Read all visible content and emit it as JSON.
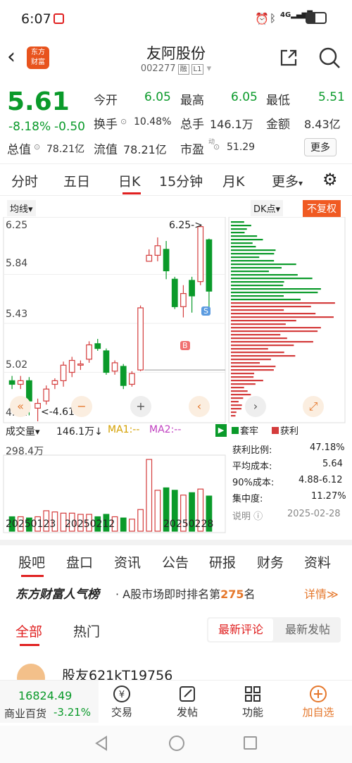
{
  "status": {
    "time": "6:07",
    "icons": [
      "notification-icon",
      "alarm-icon",
      "bluetooth-icon",
      "signal-icon",
      "battery-icon"
    ]
  },
  "header": {
    "title": "友阿股份",
    "code": "002277",
    "tag1": "融",
    "tag2": "L1",
    "logo": "东方\n财富"
  },
  "quote": {
    "price": "5.61",
    "change_pct": "-8.18%",
    "change": "-0.50",
    "open_label": "今开",
    "open": "6.05",
    "high_label": "最高",
    "high": "6.05",
    "low_label": "最低",
    "low": "5.51",
    "turnover_label": "换手",
    "turnover": "10.48%",
    "volume_label": "总手",
    "volume": "146.1万",
    "amount_label": "金额",
    "amount": "8.43亿",
    "mktcap_label": "总值",
    "mktcap": "78.21亿",
    "float_label": "流值",
    "float": "78.21亿",
    "pe_label": "市盈",
    "pe_sup": "动",
    "pe": "51.29",
    "more": "更多"
  },
  "tabs": [
    "分时",
    "五日",
    "日K",
    "15分钟",
    "月K",
    "更多"
  ],
  "chart": {
    "ma_label": "均线",
    "dk_label": "DK点",
    "fq_label": "不复权",
    "y_ticks": [
      "6.25",
      "5.84",
      "5.43",
      "5.02",
      "4.61"
    ],
    "high_annot": "6.25->",
    "low_annot": "<-4.61",
    "marker_b": "B",
    "marker_s": "S",
    "vol_label": "成交量",
    "vol_value": "146.1万↓",
    "ma1": "MA1:--",
    "ma2": "MA2:--",
    "vol_max": "298.4万",
    "dates": [
      "20250123",
      "20250212",
      "20250228"
    ]
  },
  "chip": {
    "legend_lock": "套牢",
    "legend_profit": "获利",
    "rows": [
      {
        "label": "获利比例:",
        "value": "47.18%"
      },
      {
        "label": "平均成本:",
        "value": "5.64"
      },
      {
        "label": "90%成本:",
        "value": "4.88-6.12"
      },
      {
        "label": "集中度:",
        "value": "11.27%"
      }
    ],
    "note": "说明",
    "date": "2025-02-28"
  },
  "news_tabs": [
    "股吧",
    "盘口",
    "资讯",
    "公告",
    "研报",
    "财务",
    "资料"
  ],
  "rank": {
    "brand": "东方财富人气榜",
    "text": "· A股市场即时排名第",
    "num": "275",
    "suffix": "名",
    "detail": "详情"
  },
  "comment_tabs": {
    "all": "全部",
    "hot": "热门",
    "latest_comment": "最新评论",
    "latest_post": "最新发帖"
  },
  "post": {
    "user": "股友621kT19756"
  },
  "bottom": {
    "index_value": "16824.49",
    "index_name": "商业百货",
    "index_change": "-3.21%",
    "trade": "交易",
    "post": "发帖",
    "func": "功能",
    "add": "加自选"
  },
  "chart_data": {
    "type": "candlestick",
    "y_range": [
      4.61,
      6.25
    ],
    "candles": [
      [
        4.95,
        4.92,
        4.99,
        4.88
      ],
      [
        4.92,
        4.95,
        4.99,
        4.88
      ],
      [
        4.95,
        4.78,
        4.98,
        4.66
      ],
      [
        4.72,
        4.76,
        4.8,
        4.61
      ],
      [
        4.78,
        4.88,
        4.91,
        4.75
      ],
      [
        4.92,
        4.95,
        4.97,
        4.88
      ],
      [
        4.95,
        5.08,
        5.11,
        4.9
      ],
      [
        5.02,
        5.12,
        5.15,
        4.98
      ],
      [
        5.08,
        5.09,
        5.12,
        5.04
      ],
      [
        5.13,
        5.25,
        5.28,
        5.1
      ],
      [
        5.26,
        5.22,
        5.3,
        5.2
      ],
      [
        5.2,
        5.02,
        5.22,
        5.0
      ],
      [
        5.03,
        5.1,
        5.12,
        5.0
      ],
      [
        5.07,
        4.91,
        5.09,
        4.88
      ],
      [
        4.92,
        5.01,
        5.03,
        4.9
      ],
      [
        5.04,
        5.56,
        5.58,
        5.03
      ],
      [
        5.95,
        6.0,
        6.05,
        5.95
      ],
      [
        6.0,
        6.08,
        6.15,
        5.95
      ],
      [
        6.05,
        5.87,
        6.12,
        5.8
      ],
      [
        5.8,
        5.57,
        5.82,
        5.55
      ],
      [
        5.57,
        5.68,
        5.75,
        5.48
      ],
      [
        5.79,
        5.66,
        5.82,
        5.52
      ],
      [
        5.78,
        6.24,
        6.25,
        5.75
      ],
      [
        6.13,
        5.7,
        6.14,
        5.55
      ]
    ],
    "volumes": [
      60,
      60,
      55,
      60,
      85,
      80,
      75,
      75,
      70,
      70,
      60,
      70,
      60,
      55,
      50,
      90,
      298,
      170,
      180,
      170,
      150,
      160,
      175,
      146
    ],
    "volume_max": 298.4
  }
}
